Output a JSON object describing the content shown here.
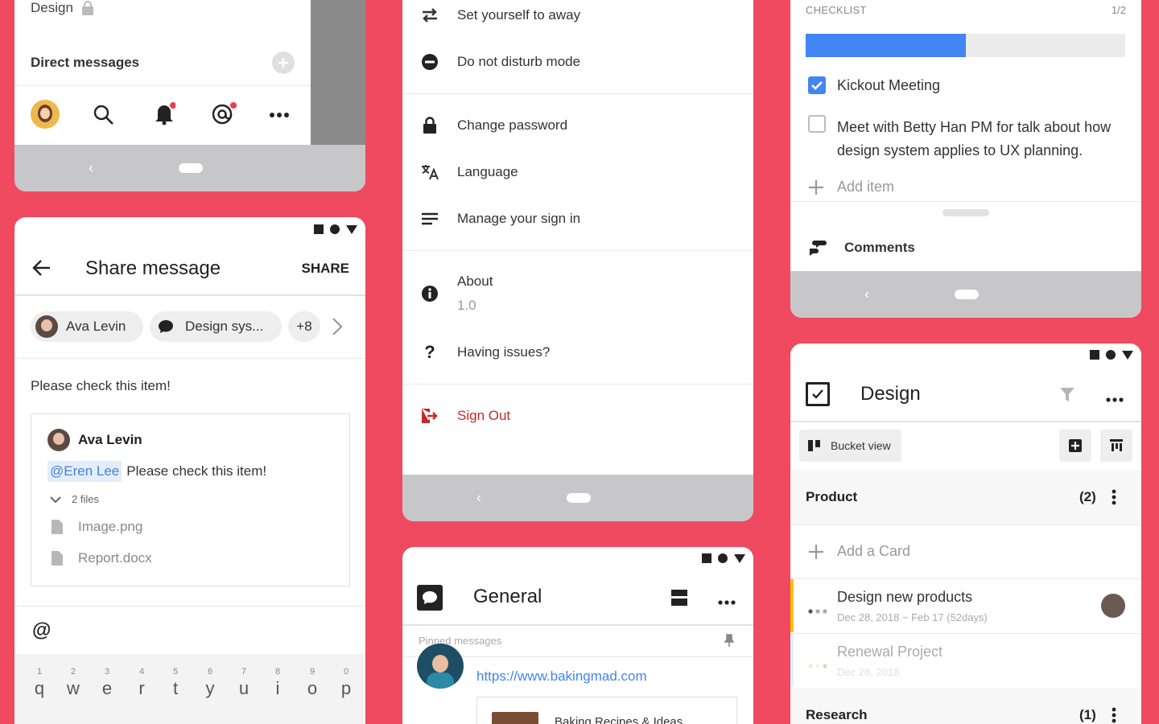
{
  "colors": {
    "background": "#ef4a5f",
    "accent_blue": "#4285f4",
    "danger": "#c62828"
  },
  "card_sidebar": {
    "channel_label": "Design",
    "dm_label": "Direct messages",
    "bottom_icons": [
      "avatar",
      "search-icon",
      "bell-icon",
      "mention-icon",
      "more-icon"
    ]
  },
  "share_message": {
    "title": "Share message",
    "share_action": "SHARE",
    "recipients": [
      {
        "label": "Ava Levin",
        "icon": "avatar"
      },
      {
        "label": "Design sys...",
        "icon": "chat-bubble-icon"
      }
    ],
    "more_count": "+8",
    "message_text": "Please check this item!",
    "quote": {
      "author": "Ava Levin",
      "mention": "@Eren Lee",
      "text": "Please check this item!",
      "files_label": "2 files",
      "files": [
        "Image.png",
        "Report.docx"
      ]
    },
    "composer_symbol": "@",
    "keyboard": {
      "numbers": [
        "1",
        "2",
        "3",
        "4",
        "5",
        "6",
        "7",
        "8",
        "9",
        "0"
      ],
      "letters": [
        "q",
        "w",
        "e",
        "r",
        "t",
        "y",
        "u",
        "i",
        "o",
        "p"
      ]
    }
  },
  "settings_menu": {
    "items": [
      {
        "label": "Set yourself to away",
        "icon": "swap-icon"
      },
      {
        "label": "Do not disturb mode",
        "icon": "minus-circle-icon"
      },
      {
        "label": "Change password",
        "icon": "lock-icon"
      },
      {
        "label": "Language",
        "icon": "translate-icon"
      },
      {
        "label": "Manage your sign in",
        "icon": "list-icon"
      }
    ],
    "about_label": "About",
    "about_version": "1.0",
    "issues_label": "Having issues?",
    "sign_out_label": "Sign Out"
  },
  "general_channel": {
    "title": "General",
    "pinned_label": "Pinned messages",
    "link_text": "https://www.bakingmad.com",
    "link_preview_title": "Baking Recipes & Ideas"
  },
  "checklist": {
    "header": "CHECKLIST",
    "count": "1/2",
    "progress": 0.5,
    "items": [
      {
        "text": "Kickout Meeting",
        "checked": true
      },
      {
        "text": "Meet with Betty Han PM for talk about how design system applies to UX planning.",
        "checked": false
      }
    ],
    "add_item_label": "Add item",
    "comments_label": "Comments"
  },
  "design_board": {
    "title": "Design",
    "view_label": "Bucket view",
    "sections": [
      {
        "name": "Product",
        "count": "(2)"
      },
      {
        "name": "Research",
        "count": "(1)"
      }
    ],
    "add_card_label": "Add a Card",
    "cards": [
      {
        "title": "Design new products",
        "dates": "Dec 28, 2018 ~ Feb 17 (52days)",
        "color": "#ffc107"
      },
      {
        "title": "Renewal Project",
        "dates": "Dec 28, 2018",
        "color": "#b3e5fc"
      }
    ]
  }
}
